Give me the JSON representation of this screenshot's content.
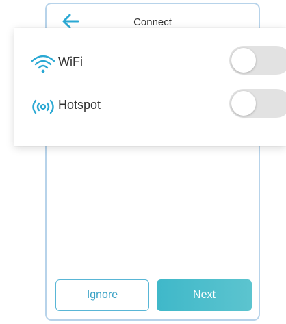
{
  "header": {
    "title": "Connect",
    "back_icon": "arrow-left-icon",
    "accent_color": "#2aa8d3"
  },
  "connections": [
    {
      "label": "WiFi",
      "icon": "wifi-icon",
      "enabled": false
    },
    {
      "label": "Hotspot",
      "icon": "hotspot-icon",
      "enabled": false
    }
  ],
  "footer": {
    "ignore_label": "Ignore",
    "next_label": "Next"
  }
}
